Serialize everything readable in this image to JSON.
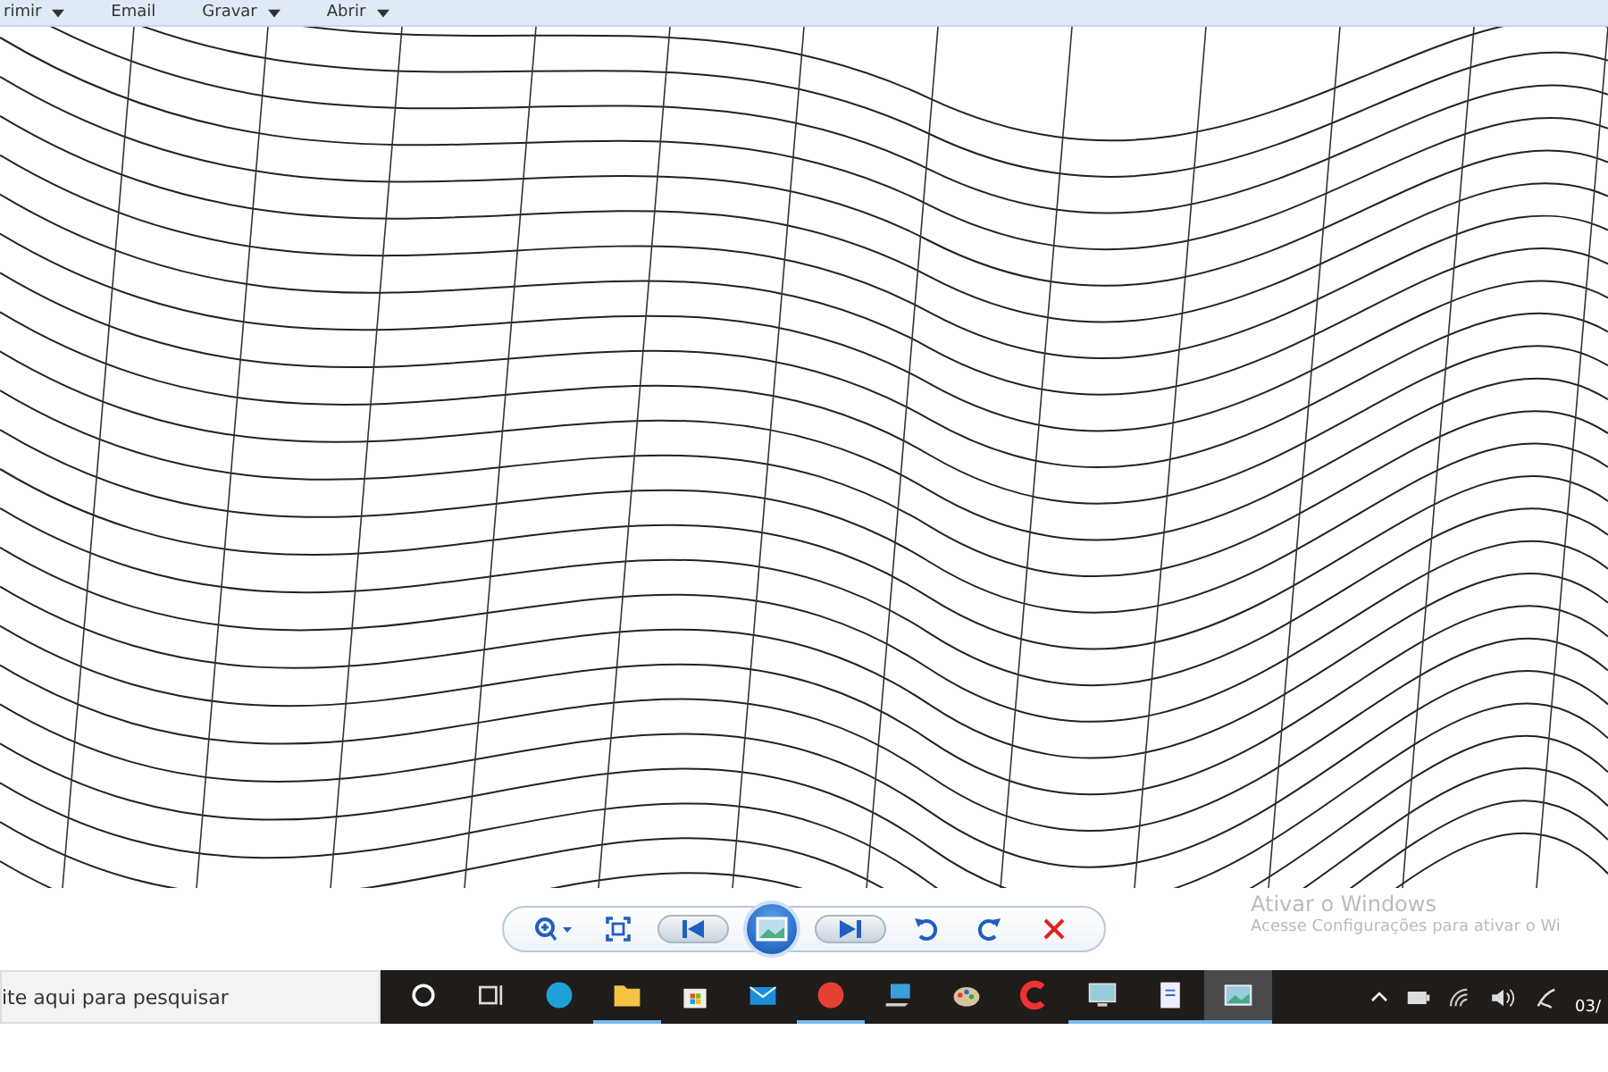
{
  "menu": [
    {
      "label": "rimir",
      "dropdown": true
    },
    {
      "label": "Email",
      "dropdown": false
    },
    {
      "label": "Gravar",
      "dropdown": true
    },
    {
      "label": "Abrir",
      "dropdown": true
    }
  ],
  "activation_notice": {
    "title": "Ativar o Windows",
    "text": "Acesse Configurações para ativar o Wi"
  },
  "viewer_controls": [
    {
      "kind": "zoom"
    },
    {
      "kind": "fit"
    },
    {
      "kind": "prev"
    },
    {
      "kind": "slideshow"
    },
    {
      "kind": "next"
    },
    {
      "kind": "rotate-left"
    },
    {
      "kind": "rotate-right"
    },
    {
      "kind": "delete"
    }
  ],
  "taskbar": {
    "search": {
      "placeholder": "ite aqui para pesquisar"
    },
    "apps": [
      {
        "kind": "cortana",
        "running": false,
        "selected": false
      },
      {
        "kind": "taskview",
        "running": false,
        "selected": false
      },
      {
        "kind": "edge",
        "running": false,
        "selected": false
      },
      {
        "kind": "folder",
        "running": true,
        "selected": false
      },
      {
        "kind": "store",
        "running": false,
        "selected": false
      },
      {
        "kind": "mail",
        "running": false,
        "selected": false
      },
      {
        "kind": "chrome",
        "running": true,
        "selected": false
      },
      {
        "kind": "laptop",
        "running": false,
        "selected": false
      },
      {
        "kind": "palette",
        "running": false,
        "selected": false
      },
      {
        "kind": "ccleaner",
        "running": false,
        "selected": false
      },
      {
        "kind": "monitor",
        "running": true,
        "selected": false
      },
      {
        "kind": "document",
        "running": true,
        "selected": false
      },
      {
        "kind": "photo",
        "running": true,
        "selected": true
      }
    ],
    "clock": "03/"
  }
}
